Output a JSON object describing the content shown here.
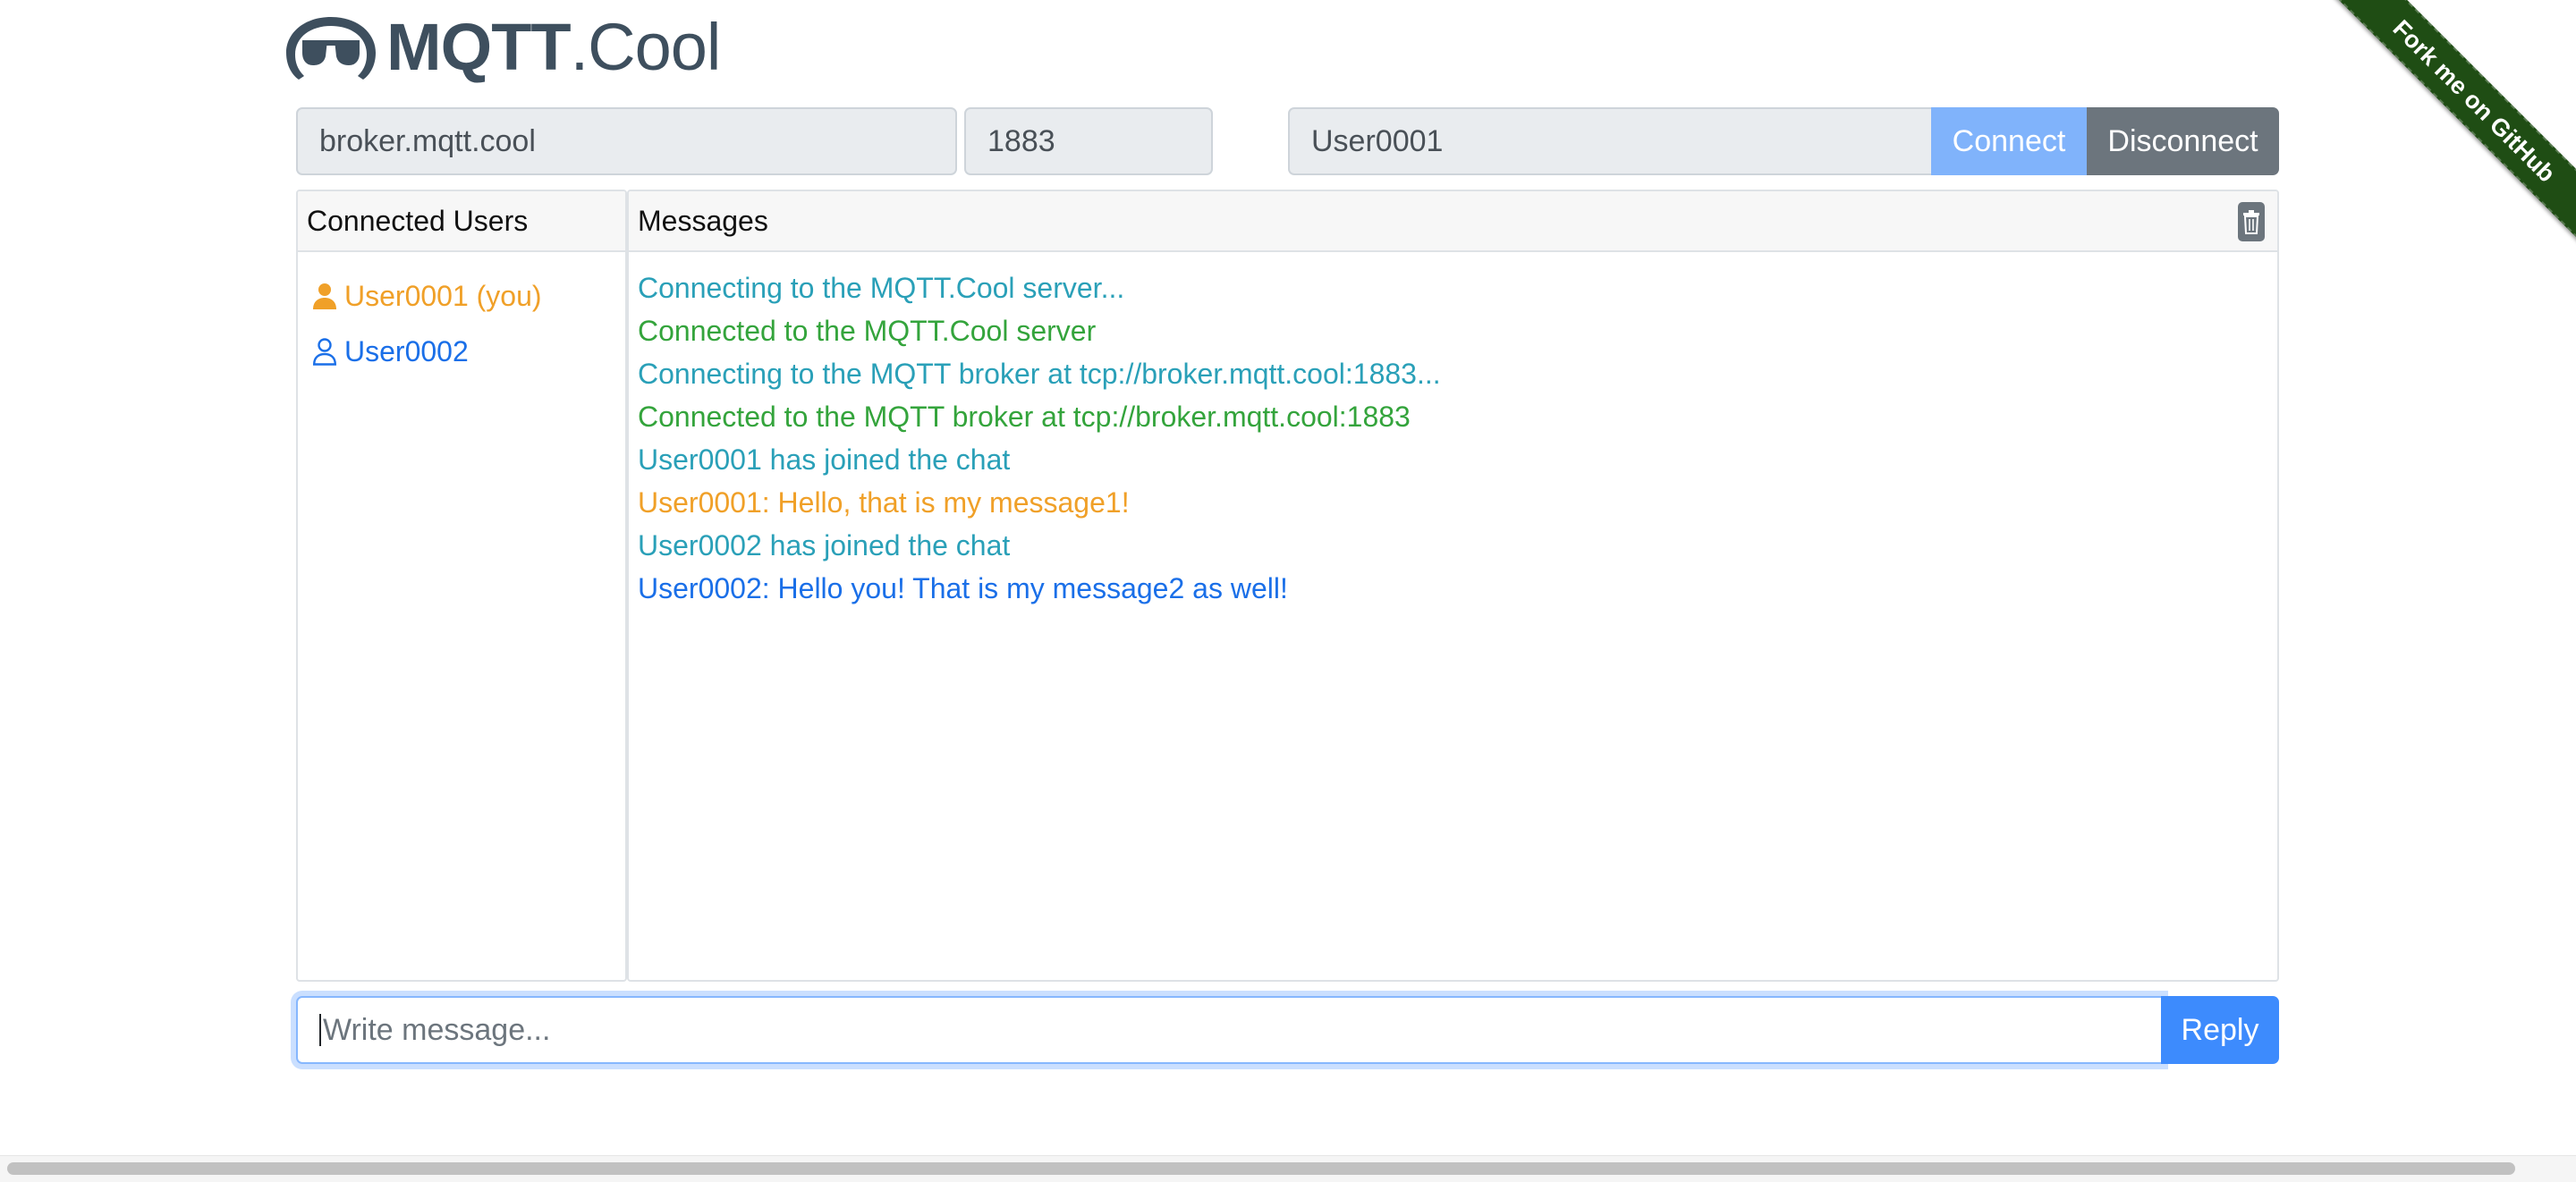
{
  "logo": {
    "brand_bold": "MQTT",
    "brand_light": ".Cool",
    "icon": "glasses-logo-icon"
  },
  "connection": {
    "broker": "broker.mqtt.cool",
    "port": "1883",
    "username": "User0001",
    "connect_label": "Connect",
    "disconnect_label": "Disconnect"
  },
  "users_panel": {
    "title": "Connected Users",
    "users": [
      {
        "label": "User0001 (you)",
        "icon": "user-filled-icon",
        "color": "#f0a028"
      },
      {
        "label": "User0002",
        "icon": "user-outline-icon",
        "color": "#1a6fe8"
      }
    ]
  },
  "messages_panel": {
    "title": "Messages",
    "clear_icon": "trash-icon",
    "messages": [
      {
        "text": "Connecting to the MQTT.Cool server...",
        "kind": "info"
      },
      {
        "text": "Connected to the MQTT.Cool server",
        "kind": "ok"
      },
      {
        "text": "Connecting to the MQTT broker at tcp://broker.mqtt.cool:1883...",
        "kind": "info"
      },
      {
        "text": "Connected to the MQTT broker at tcp://broker.mqtt.cool:1883",
        "kind": "ok"
      },
      {
        "text": "User0001 has joined the chat",
        "kind": "info"
      },
      {
        "text": "User0001: Hello, that is my message1!",
        "kind": "self"
      },
      {
        "text": "User0002 has joined the chat",
        "kind": "info"
      },
      {
        "text": "User0002: Hello you! That is my message2 as well!",
        "kind": "other"
      }
    ]
  },
  "reply": {
    "placeholder": "Write message...",
    "button_label": "Reply"
  },
  "ribbon": {
    "label": "Fork me on GitHub"
  },
  "colors": {
    "info": "#2aa0b8",
    "ok": "#34a43c",
    "self": "#f0a028",
    "other": "#1a6fe8",
    "primary": "#3d8bfd"
  }
}
